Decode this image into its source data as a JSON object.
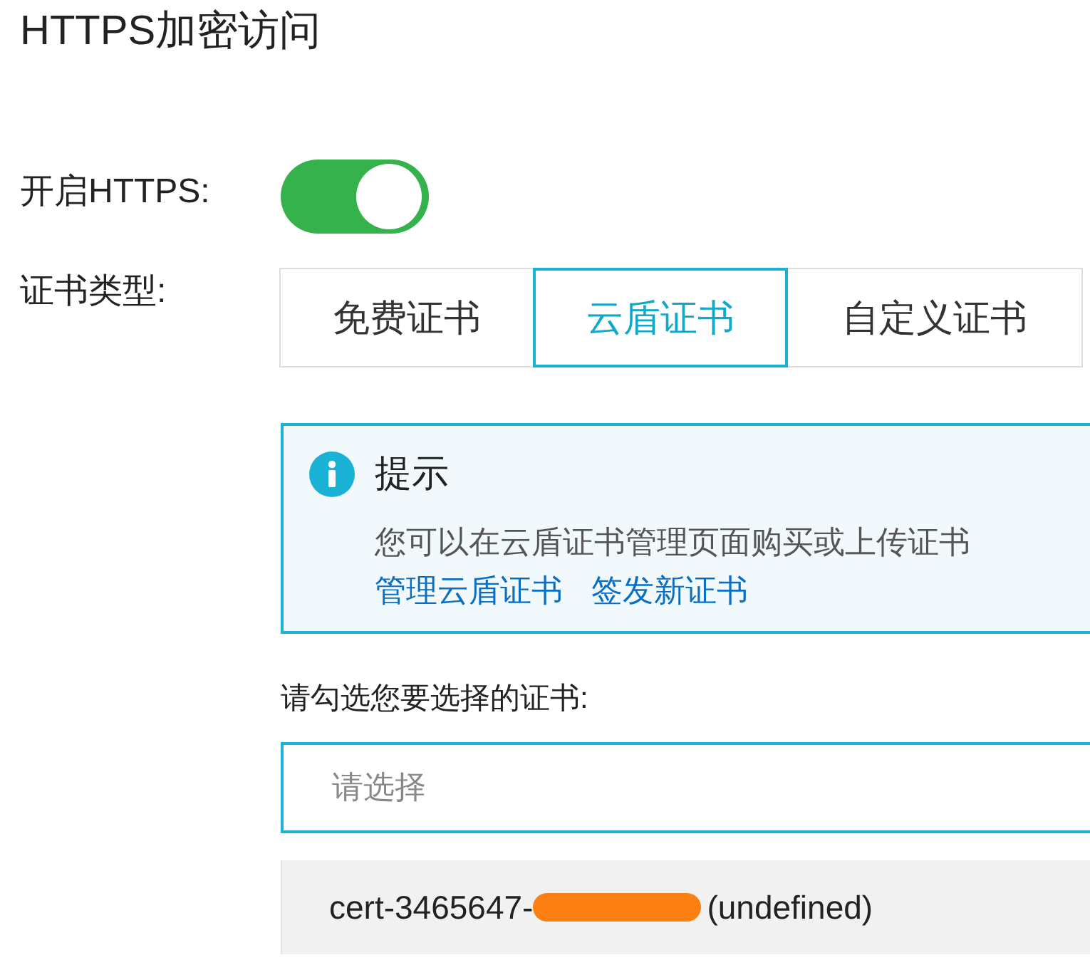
{
  "title": "HTTPS加密访问",
  "https_toggle": {
    "label": "开启HTTPS:",
    "on": true
  },
  "cert_type": {
    "label": "证书类型:",
    "tabs": [
      {
        "label": "免费证书",
        "selected": false
      },
      {
        "label": "云盾证书",
        "selected": true
      },
      {
        "label": "自定义证书",
        "selected": false
      }
    ]
  },
  "notice": {
    "title": "提示",
    "text": "您可以在云盾证书管理页面购买或上传证书",
    "links": [
      "管理云盾证书",
      "签发新证书"
    ]
  },
  "cert_select": {
    "label": "请勾选您要选择的证书:",
    "placeholder": "请选择",
    "options": [
      {
        "prefix": "cert-3465647-",
        "suffix": "(undefined)",
        "redacted": true
      }
    ]
  }
}
